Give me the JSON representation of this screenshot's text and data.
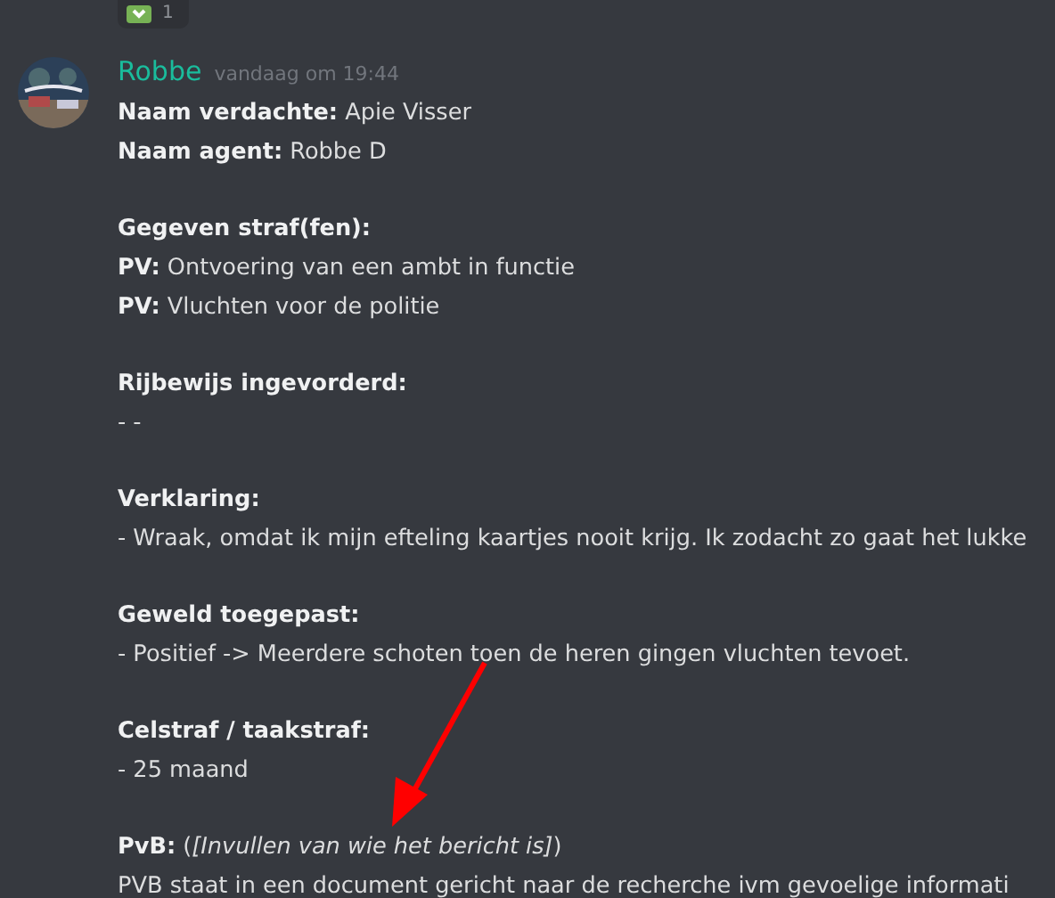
{
  "reaction": {
    "count": "1",
    "selected": false
  },
  "message": {
    "author": "Robbe",
    "color": "#1abc9c",
    "timestamp": "vandaag om 19:44",
    "lines": [
      {
        "kind": "text",
        "text": "**Naam verdachte:** Apie Visser"
      },
      {
        "kind": "text",
        "text": "**Naam agent:** Robbe D"
      },
      {
        "kind": "blank"
      },
      {
        "kind": "text",
        "text": "**Gegeven straf(fen):**"
      },
      {
        "kind": "text",
        "text": "**PV:** Ontvoering van een ambt in functie"
      },
      {
        "kind": "text",
        "text": "**PV:** Vluchten voor de politie"
      },
      {
        "kind": "blank"
      },
      {
        "kind": "text",
        "text": "**Rijbewijs ingevorderd:**"
      },
      {
        "kind": "text",
        "text": "- -"
      },
      {
        "kind": "blank"
      },
      {
        "kind": "text",
        "text": "**Verklaring:**"
      },
      {
        "kind": "text",
        "text": "- Wraak, omdat ik mijn efteling kaartjes nooit krijg. Ik zodacht zo gaat het lukke"
      },
      {
        "kind": "blank"
      },
      {
        "kind": "text",
        "text": "**Geweld toegepast:**"
      },
      {
        "kind": "text",
        "text": "- Positief -> Meerdere schoten toen de heren gingen vluchten tevoet."
      },
      {
        "kind": "blank"
      },
      {
        "kind": "text",
        "text": "**Celstraf / taakstraf:**"
      },
      {
        "kind": "text",
        "text": "- 25 maand"
      },
      {
        "kind": "blank"
      },
      {
        "kind": "text",
        "text": "**PvB:** (*[Invullen van wie het bericht is]*)"
      },
      {
        "kind": "text",
        "text": "PVB staat in een document gericht naar de recherche ivm gevoelige informati"
      }
    ]
  }
}
